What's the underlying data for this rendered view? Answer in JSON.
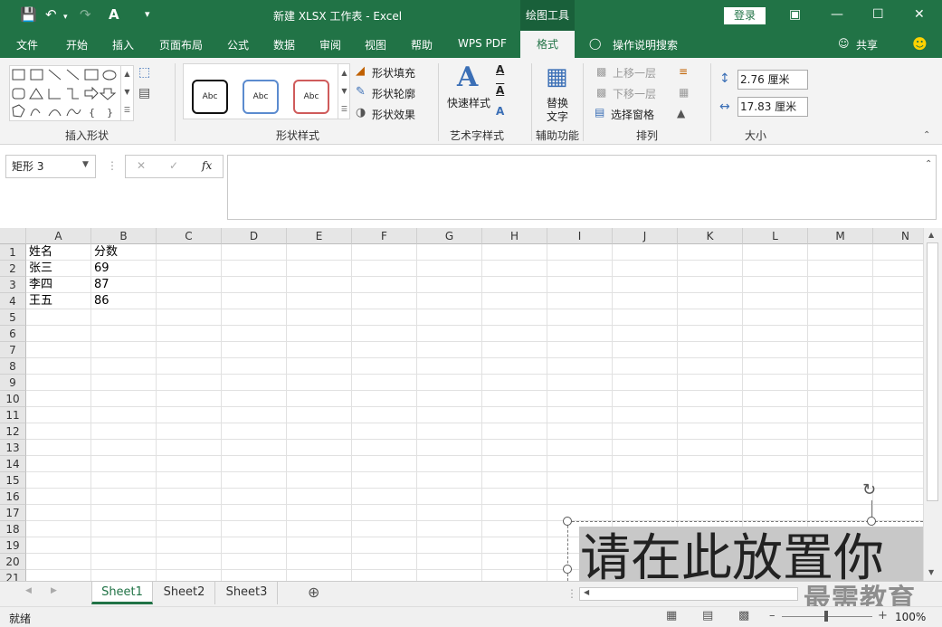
{
  "titlebar": {
    "title": "新建 XLSX 工作表  -  Excel",
    "context_tab": "绘图工具",
    "login": "登录"
  },
  "menu": {
    "file": "文件",
    "home": "开始",
    "insert": "插入",
    "layout": "页面布局",
    "formulas": "公式",
    "data": "数据",
    "review": "审阅",
    "view": "视图",
    "help": "帮助",
    "wps": "WPS PDF",
    "format": "格式",
    "tellme": "操作说明搜索",
    "share": "共享"
  },
  "ribbon": {
    "group_insert_shapes": "插入形状",
    "group_shape_styles": "形状样式",
    "style_sample": "Abc",
    "shape_fill": "形状填充",
    "shape_outline": "形状轮廓",
    "shape_effects": "形状效果",
    "quick_styles": "快速样式",
    "group_wordart": "艺术字样式",
    "alt_text_1": "替换",
    "alt_text_2": "文字",
    "group_accessibility": "辅助功能",
    "bring_forward": "上移一层",
    "send_backward": "下移一层",
    "selection_pane": "选择窗格",
    "group_arrange": "排列",
    "height": "2.76 厘米",
    "width": "17.83 厘米",
    "group_size": "大小"
  },
  "formula_bar": {
    "name_box": "矩形 3",
    "formula": ""
  },
  "grid": {
    "columns": [
      "A",
      "B",
      "C",
      "D",
      "E",
      "F",
      "G",
      "H",
      "I",
      "J",
      "K",
      "L",
      "M",
      "N"
    ],
    "rows": [
      "1",
      "2",
      "3",
      "4",
      "5",
      "6",
      "7",
      "8",
      "9",
      "10",
      "11",
      "12",
      "13",
      "14",
      "15",
      "16",
      "17",
      "18",
      "19",
      "20",
      "21"
    ],
    "cells": [
      [
        "姓名",
        "分数"
      ],
      [
        "张三",
        "69"
      ],
      [
        "李四",
        "87"
      ],
      [
        "王五",
        "86"
      ]
    ]
  },
  "shape": {
    "text": "请在此放置你"
  },
  "sheets": [
    "Sheet1",
    "Sheet2",
    "Sheet3"
  ],
  "status": {
    "ready": "就绪",
    "zoom": "100%"
  },
  "watermark": "最需教育",
  "colors": {
    "brand": "#217346",
    "context_tab": "#19603a",
    "ribbon_bg": "#f3f3f3"
  }
}
